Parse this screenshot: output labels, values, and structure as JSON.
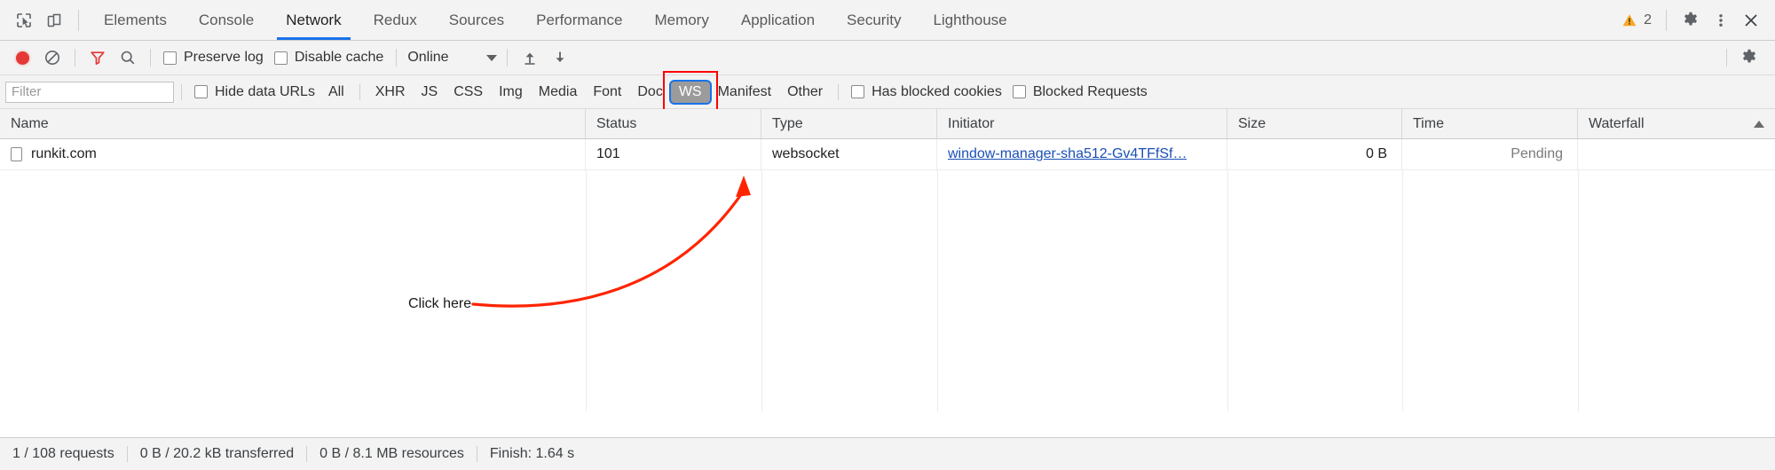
{
  "window": {
    "tabs": [
      {
        "label": "Elements",
        "active": false
      },
      {
        "label": "Console",
        "active": false
      },
      {
        "label": "Network",
        "active": true
      },
      {
        "label": "Redux",
        "active": false
      },
      {
        "label": "Sources",
        "active": false
      },
      {
        "label": "Performance",
        "active": false
      },
      {
        "label": "Memory",
        "active": false
      },
      {
        "label": "Application",
        "active": false
      },
      {
        "label": "Security",
        "active": false
      },
      {
        "label": "Lighthouse",
        "active": false
      }
    ],
    "inspect_icon": "inspect-cursor-icon",
    "device_icon": "device-toggle-icon",
    "warning_count": "2",
    "warning_icon": "warning-triangle-icon",
    "settings_icon": "gear-icon",
    "more_icon": "kebab-menu-icon",
    "close_icon": "close-icon",
    "accent_color": "#1a73e8",
    "warning_color": "#f9a825"
  },
  "controls": {
    "record_icon": "record-button-icon",
    "record_color": "#e53935",
    "clear_icon": "clear-icon",
    "filter_icon": "funnel-icon",
    "filter_icon_color": "#e53935",
    "search_icon": "search-icon",
    "preserve_log_label": "Preserve log",
    "preserve_log_checked": false,
    "disable_cache_label": "Disable cache",
    "disable_cache_checked": false,
    "throttle_value": "Online",
    "throttle_caret_icon": "chevron-down-icon",
    "import_icon": "import-har-icon",
    "export_icon": "export-har-icon",
    "settings_icon": "gear-icon"
  },
  "filters": {
    "placeholder": "Filter",
    "value": "",
    "hide_data_urls_label": "Hide data URLs",
    "hide_data_urls_checked": false,
    "types": [
      {
        "label": "All",
        "selected": false
      },
      {
        "label": "XHR",
        "selected": false
      },
      {
        "label": "JS",
        "selected": false
      },
      {
        "label": "CSS",
        "selected": false
      },
      {
        "label": "Img",
        "selected": false
      },
      {
        "label": "Media",
        "selected": false
      },
      {
        "label": "Font",
        "selected": false
      },
      {
        "label": "Doc",
        "selected": false
      },
      {
        "label": "WS",
        "selected": true
      },
      {
        "label": "Manifest",
        "selected": false
      },
      {
        "label": "Other",
        "selected": false
      }
    ],
    "has_blocked_cookies_label": "Has blocked cookies",
    "has_blocked_cookies_checked": false,
    "blocked_requests_label": "Blocked Requests",
    "blocked_requests_checked": false,
    "highlight_color": "#ff0000"
  },
  "table": {
    "columns": [
      {
        "key": "name",
        "label": "Name"
      },
      {
        "key": "status",
        "label": "Status"
      },
      {
        "key": "type",
        "label": "Type"
      },
      {
        "key": "initiator",
        "label": "Initiator"
      },
      {
        "key": "size",
        "label": "Size"
      },
      {
        "key": "time",
        "label": "Time"
      },
      {
        "key": "waterfall",
        "label": "Waterfall"
      }
    ],
    "sorted_column": "Waterfall",
    "sort_icon": "sort-ascending-icon",
    "rows": [
      {
        "name": "runkit.com",
        "status": "101",
        "type": "websocket",
        "initiator": "window-manager-sha512-Gv4TFfSf…",
        "size": "0 B",
        "time": "Pending",
        "waterfall": ""
      }
    ]
  },
  "annotation": {
    "label": "Click here",
    "color": "#ff0000",
    "arrow_icon": "curved-arrow-icon"
  },
  "statusbar": {
    "requests": "1 / 108 requests",
    "transferred": "0 B / 20.2 kB transferred",
    "resources": "0 B / 8.1 MB resources",
    "finish": "Finish: 1.64 s"
  }
}
